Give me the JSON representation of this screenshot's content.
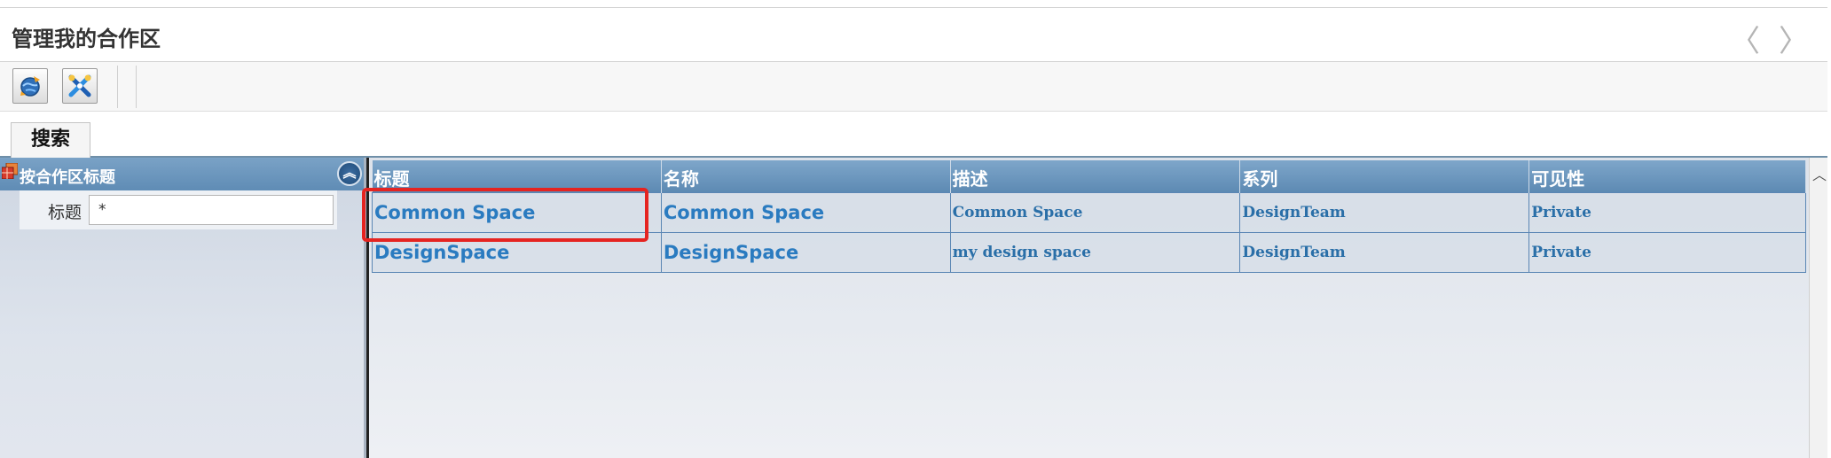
{
  "window": {
    "title": "管理我的合作区",
    "nav_prev": "〈",
    "nav_next": "〉"
  },
  "toolbar": {
    "buttons": [
      {
        "icon": "refresh-globe-icon"
      },
      {
        "icon": "collaborate-tools-icon"
      }
    ]
  },
  "tabs": [
    {
      "label": "搜索",
      "active": true
    }
  ],
  "search_panel": {
    "header": "按合作区标题",
    "field_label": "标题",
    "field_value": "*"
  },
  "grid": {
    "columns": [
      "标题",
      "名称",
      "描述",
      "系列",
      "可见性"
    ],
    "rows": [
      {
        "title": "Common Space",
        "name": "Common Space",
        "description": "Common Space",
        "series": "DesignTeam",
        "visibility": "Private"
      },
      {
        "title": "DesignSpace",
        "name": "DesignSpace",
        "description": "my design space",
        "series": "DesignTeam",
        "visibility": "Private"
      }
    ]
  },
  "colors": {
    "header_blue": "#6a94bc",
    "link_blue": "#2a7bc0",
    "highlight_red": "#e52421"
  }
}
